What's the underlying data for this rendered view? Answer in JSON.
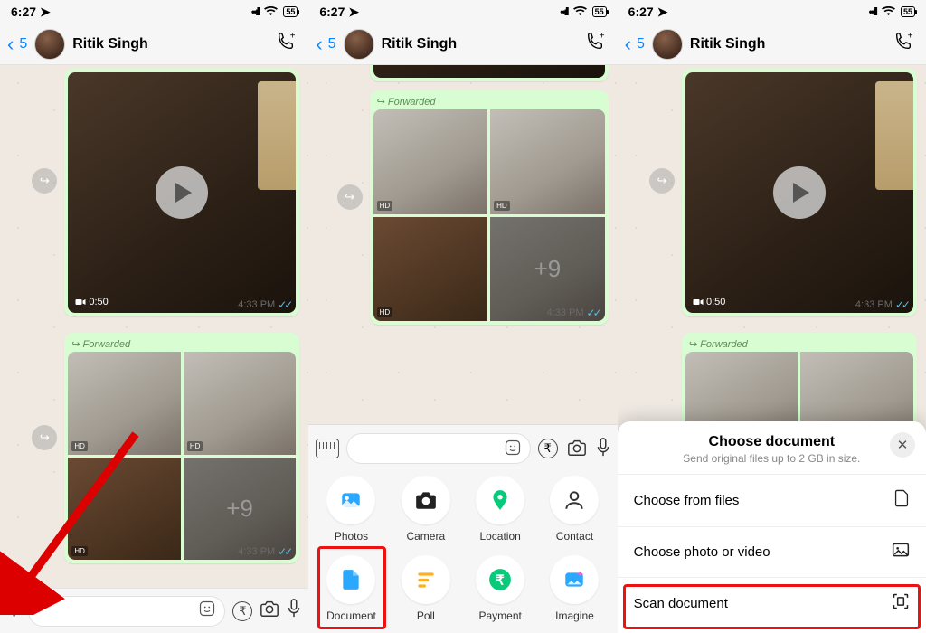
{
  "status": {
    "time": "6:27",
    "loc_icon": "↗",
    "signal": "••ıll",
    "wifi": "wifi",
    "battery": "55"
  },
  "header": {
    "back_count": "5",
    "name": "Ritik Singh"
  },
  "chat": {
    "video": {
      "duration": "0:50",
      "time": "4:33 PM"
    },
    "gallery": {
      "forwarded": "Forwarded",
      "more": "+9",
      "hd": "HD",
      "time": "4:33 PM"
    }
  },
  "attach": {
    "photos": "Photos",
    "camera": "Camera",
    "location": "Location",
    "contact": "Contact",
    "document": "Document",
    "poll": "Poll",
    "payment": "Payment",
    "imagine": "Imagine"
  },
  "docsheet": {
    "title": "Choose document",
    "subtitle": "Send original files up to 2 GB in size.",
    "opt1": "Choose from files",
    "opt2": "Choose photo or video",
    "opt3": "Scan document"
  }
}
